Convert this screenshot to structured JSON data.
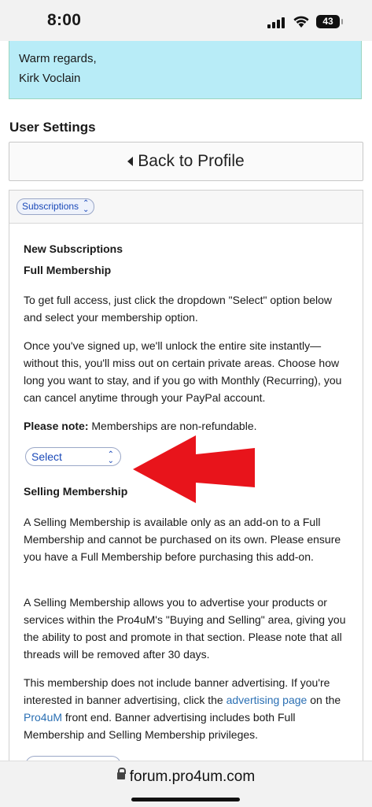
{
  "status_bar": {
    "time": "8:00",
    "battery": "43"
  },
  "quote": {
    "line1": "Warm regards,",
    "line2": "Kirk Voclain"
  },
  "page": {
    "section_title": "User Settings",
    "back_button": "Back to Profile"
  },
  "panel": {
    "subscriptions_select": "Subscriptions",
    "new_subscriptions_heading": "New Subscriptions",
    "full_membership_heading": "Full Membership",
    "para1": "To get full access, just click the dropdown \"Select\" option below and select your membership option.",
    "para2": "Once you've signed up, we'll unlock the entire site instantly— without this, you'll miss out on certain private areas. Choose how long you want to stay, and if you go with Monthly (Recurring), you can cancel anytime through your PayPal account.",
    "note_label": "Please note:",
    "note_text": " Memberships are non-refundable.",
    "select_label": "Select",
    "selling_heading": "Selling Membership",
    "para3": "A Selling Membership is available only as an add-on to a Full Membership and cannot be purchased on its own. Please ensure you have a Full Membership before purchasing this add-on.",
    "para4": "A Selling Membership allows you to advertise your products or services within the Pro4uM's \"Buying and Selling\" area, giving you the ability to post and promote in that section. Please note that all threads will be removed after 30 days.",
    "para5_a": "This membership does not include banner advertising. If you're interested in banner advertising, click the ",
    "para5_link1": "advertising page",
    "para5_b": " on the ",
    "para5_link2": "Pro4uM",
    "para5_c": " front end. Banner advertising includes both Full Membership and Selling Membership privileges."
  },
  "url_bar": {
    "domain": "forum.pro4um.com"
  },
  "colors": {
    "quote_bg": "#b8ecf7",
    "link": "#2a6fb3",
    "select_text": "#1a49b8",
    "arrow": "#e8141b"
  }
}
